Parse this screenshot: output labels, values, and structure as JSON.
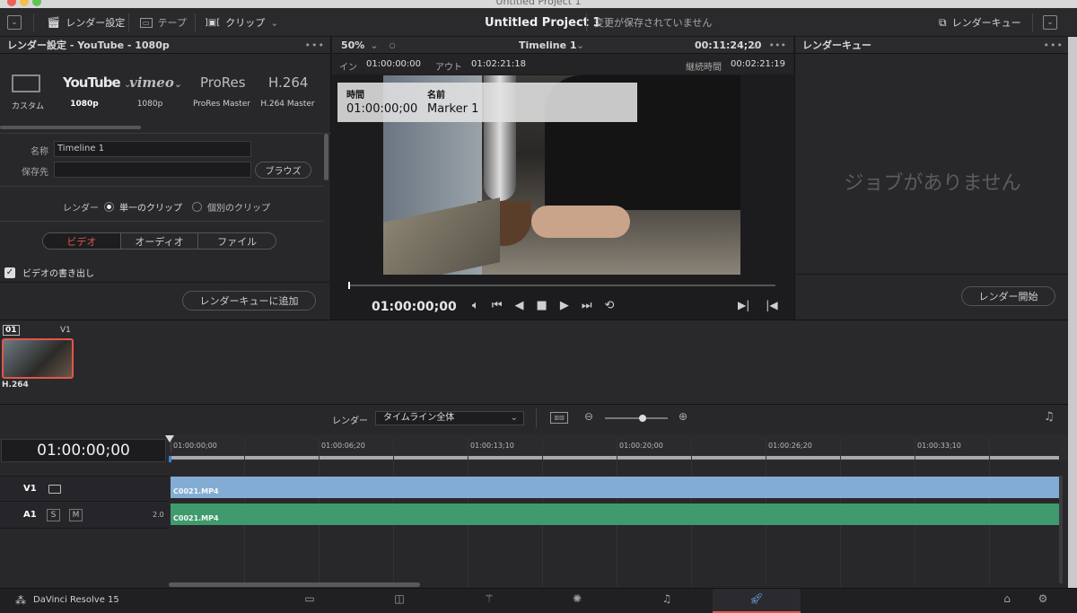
{
  "window": {
    "title": "Untitled Project 1"
  },
  "toolbar": {
    "render_settings": "レンダー設定",
    "tape": "テープ",
    "clip": "クリップ",
    "project_name": "Untitled Project 1",
    "unsaved_status": "変更が保存されていません",
    "render_queue": "レンダーキュー"
  },
  "render_panel": {
    "header": "レンダー設定 - YouTube - 1080p",
    "presets": [
      {
        "logo": "",
        "label": "カスタム"
      },
      {
        "logo": "YouTube",
        "label": "1080p"
      },
      {
        "logo": "vimeo",
        "label": "1080p"
      },
      {
        "logo": "ProRes",
        "label": "ProRes Master"
      },
      {
        "logo": "H.264",
        "label": "H.264 Master"
      }
    ],
    "name_label": "名称",
    "name_value": "Timeline 1",
    "location_label": "保存先",
    "location_value": "",
    "browse": "ブラウズ",
    "render_label": "レンダー",
    "single_clip": "単一のクリップ",
    "individual_clips": "個別のクリップ",
    "tabs": [
      "ビデオ",
      "オーディオ",
      "ファイル"
    ],
    "export_video": "ビデオの書き出し",
    "add_to_queue": "レンダーキューに追加"
  },
  "viewer": {
    "zoom": "50%",
    "timeline_name": "Timeline 1",
    "timecode_top": "00:11:24;20",
    "in_label": "イン",
    "in_value": "01:00:00:00",
    "out_label": "アウト",
    "out_value": "01:02:21:18",
    "duration_label": "継続時間",
    "duration_value": "00:02:21:19",
    "marker_time_label": "時間",
    "marker_name_label": "名前",
    "marker_time": "01:00:00;00",
    "marker_name": "Marker 1",
    "current_timecode": "01:00:00;00",
    "playhead_progress": 0
  },
  "queue": {
    "header": "レンダーキュー",
    "empty_message": "ジョブがありません",
    "start_render": "レンダー開始"
  },
  "clipstrip": {
    "number": "01",
    "track": "V1",
    "codec": "H.264"
  },
  "timeline": {
    "render_label": "レンダー",
    "render_range": "タイムライン全体",
    "timecode": "01:00:00;00",
    "ruler": [
      "01:00:00;00",
      "01:00:06;20",
      "01:00:13;10",
      "01:00:20;00",
      "01:00:26;20",
      "01:00:33;10"
    ],
    "v1_label": "V1",
    "a1_label": "A1",
    "solo": "S",
    "mute": "M",
    "a1_level": "2.0",
    "video_clip": "C0021.MP4",
    "audio_clip": "C0021.MP4",
    "zoom_level": 0.6
  },
  "bottombar": {
    "app_name": "DaVinci Resolve 15"
  },
  "colors": {
    "accent_red": "#e1564a",
    "video_clip": "#7fa8cf",
    "audio_clip": "#3d9a6b"
  }
}
